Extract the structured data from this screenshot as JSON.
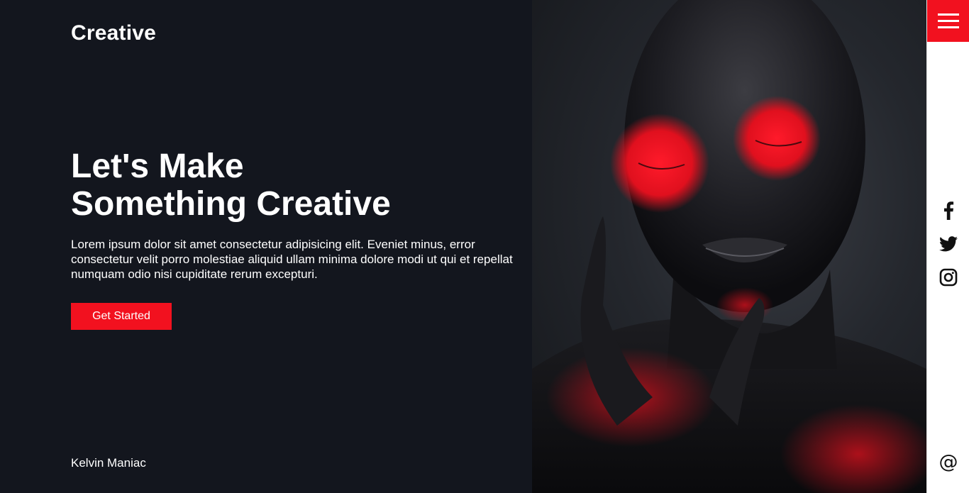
{
  "brand": {
    "logo": "Creative"
  },
  "hero": {
    "title_line1": "Let's Make",
    "title_line2": "Something Creative",
    "description": "Lorem ipsum dolor sit amet consectetur adipisicing elit. Eveniet minus, error consectetur velit porro molestiae aliquid ullam minima dolore modi ut qui et repellat numquam odio nisi cupiditate rerum excepturi.",
    "cta_label": "Get Started"
  },
  "footer": {
    "author": "Kelvin Maniac"
  },
  "sidebar": {
    "menu_icon": "hamburger-menu-icon",
    "social": [
      "facebook-icon",
      "twitter-icon",
      "instagram-icon"
    ],
    "contact_icon": "at-sign-icon",
    "contact_symbol": "@"
  },
  "colors": {
    "background": "#13161e",
    "accent": "#f2111f",
    "text": "#ffffff",
    "sidebar": "#ffffff"
  }
}
